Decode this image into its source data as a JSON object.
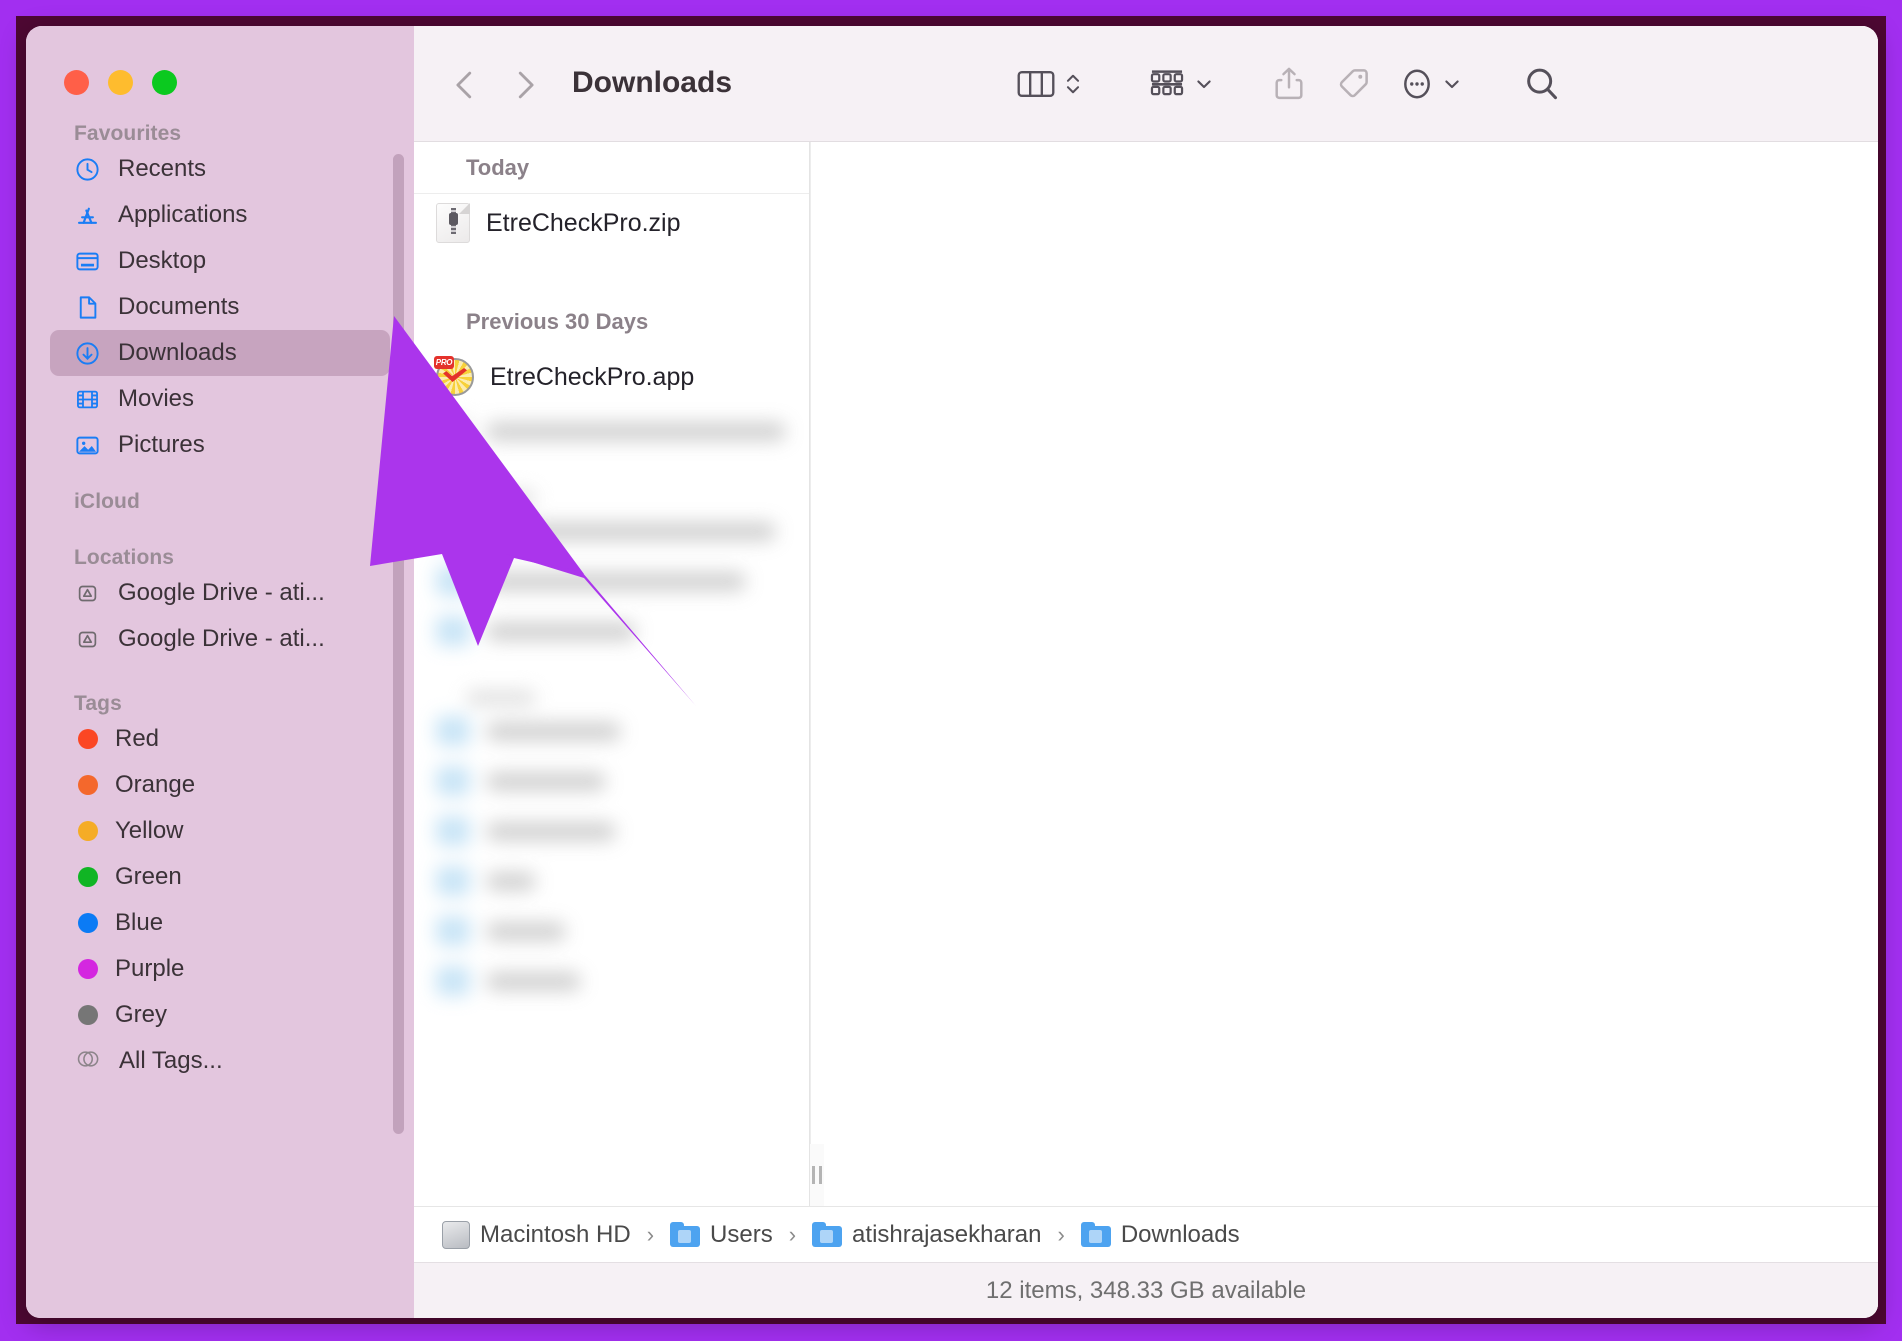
{
  "window": {
    "title": "Downloads",
    "traffic_lights": [
      {
        "name": "close",
        "color": "#ff5f48"
      },
      {
        "name": "minimize",
        "color": "#febc2e"
      },
      {
        "name": "maximize",
        "color": "#0bc91f"
      }
    ]
  },
  "toolbar": {
    "back_icon": "chevron-left-icon",
    "forward_icon": "chevron-right-icon",
    "title": "Downloads",
    "view_mode_icon": "column-view-icon",
    "view_mode_chevrons": "up-down-chevron-icon",
    "group_by_icon": "group-by-icon",
    "group_by_chevron": "chevron-down-icon",
    "share_icon": "share-icon",
    "tag_icon": "tag-icon",
    "more_icon": "ellipsis-circle-icon",
    "more_chevron": "chevron-down-icon",
    "search_icon": "search-icon"
  },
  "sidebar": {
    "sections": [
      {
        "title": "Favourites",
        "items": [
          {
            "label": "Recents",
            "icon": "clock-icon",
            "active": false
          },
          {
            "label": "Applications",
            "icon": "app-store-icon",
            "active": false
          },
          {
            "label": "Desktop",
            "icon": "desktop-icon",
            "active": false
          },
          {
            "label": "Documents",
            "icon": "document-icon",
            "active": false
          },
          {
            "label": "Downloads",
            "icon": "download-icon",
            "active": true
          },
          {
            "label": "Movies",
            "icon": "film-icon",
            "active": false
          },
          {
            "label": "Pictures",
            "icon": "photo-icon",
            "active": false
          }
        ]
      },
      {
        "title": "iCloud",
        "items": []
      },
      {
        "title": "Locations",
        "items": [
          {
            "label": "Google Drive - ati...",
            "icon": "google-drive-icon",
            "active": false
          },
          {
            "label": "Google Drive - ati...",
            "icon": "google-drive-icon",
            "active": false
          }
        ]
      },
      {
        "title": "Tags",
        "items": [
          {
            "label": "Red",
            "icon": "tag-dot-icon",
            "color": "#fb4724",
            "active": false
          },
          {
            "label": "Orange",
            "icon": "tag-dot-icon",
            "color": "#f4682c",
            "active": false
          },
          {
            "label": "Yellow",
            "icon": "tag-dot-icon",
            "color": "#f5ac26",
            "active": false
          },
          {
            "label": "Green",
            "icon": "tag-dot-icon",
            "color": "#10b524",
            "active": false
          },
          {
            "label": "Blue",
            "icon": "tag-dot-icon",
            "color": "#0b7bf5",
            "active": false
          },
          {
            "label": "Purple",
            "icon": "tag-dot-icon",
            "color": "#d427e0",
            "active": false
          },
          {
            "label": "Grey",
            "icon": "tag-dot-icon",
            "color": "#767676",
            "active": false
          },
          {
            "label": "All Tags...",
            "icon": "all-tags-icon",
            "color": null,
            "active": false
          }
        ]
      }
    ]
  },
  "file_list": {
    "groups": [
      {
        "header": "Today",
        "files": [
          {
            "name": "EtreCheckPro.zip",
            "icon": "zip-file-icon"
          }
        ]
      },
      {
        "header": "Previous 30 Days",
        "files": [
          {
            "name": "EtreCheckPro.app",
            "icon": "etrecheckpro-app-icon"
          }
        ]
      }
    ],
    "redacted_row_count": 10
  },
  "breadcrumb": {
    "items": [
      {
        "label": "Macintosh HD",
        "icon": "hard-drive-icon"
      },
      {
        "label": "Users",
        "icon": "folder-icon"
      },
      {
        "label": "atishrajasekharan",
        "icon": "folder-icon"
      },
      {
        "label": "Downloads",
        "icon": "folder-icon"
      }
    ],
    "separator": "›"
  },
  "status_bar": {
    "text": "12 items, 348.33 GB available"
  },
  "cursor": {
    "name": "arrow-pointer",
    "color": "#ab35ec"
  },
  "colors": {
    "frame_outer": "#a22ff0",
    "frame_inner": "#4e0833",
    "sidebar_bg": "#e3c6de",
    "toolbar_bg": "#f6f1f5",
    "accent_blue": "#1a7df5"
  }
}
